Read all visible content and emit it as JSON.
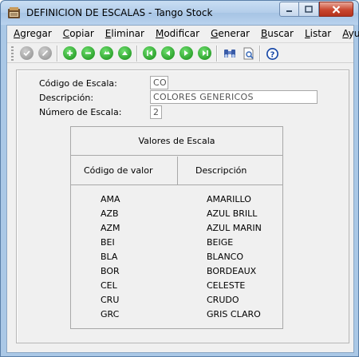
{
  "window": {
    "title": "DEFINICION DE ESCALAS - Tango Stock"
  },
  "menu": [
    {
      "label": "Agregar",
      "accel": "A",
      "rest": "gregar"
    },
    {
      "label": "Copiar",
      "accel": "C",
      "rest": "opiar"
    },
    {
      "label": "Eliminar",
      "accel": "E",
      "rest": "liminar"
    },
    {
      "label": "Modificar",
      "accel": "M",
      "rest": "odificar"
    },
    {
      "label": "Generar",
      "accel": "G",
      "rest": "enerar"
    },
    {
      "label": "Buscar",
      "accel": "B",
      "rest": "uscar"
    },
    {
      "label": "Listar",
      "accel": "L",
      "rest": "istar"
    },
    {
      "label": "Ayuda",
      "accel": "A",
      "rest": "yuda"
    }
  ],
  "toolbar": {
    "buttons": [
      "accept-icon",
      "cancel-icon",
      "add-icon",
      "remove-icon",
      "move-up-icon",
      "move-top-icon",
      "first-record-icon",
      "previous-record-icon",
      "next-record-icon",
      "last-record-icon",
      "binoculars-icon",
      "print-preview-icon",
      "help-icon"
    ]
  },
  "form": {
    "codigo_label": "Código de Escala:",
    "codigo_value": "CO",
    "descripcion_label": "Descripción:",
    "descripcion_value": "COLORES GENERICOS",
    "numero_label": "Número de Escala:",
    "numero_value": "2"
  },
  "table": {
    "title": "Valores de Escala",
    "col_code": "Código de valor",
    "col_desc": "Descripción",
    "rows": [
      {
        "code": "AMA",
        "desc": "AMARILLO"
      },
      {
        "code": "AZB",
        "desc": "AZUL BRILL"
      },
      {
        "code": "AZM",
        "desc": "AZUL MARIN"
      },
      {
        "code": "BEI",
        "desc": "BEIGE"
      },
      {
        "code": "BLA",
        "desc": "BLANCO"
      },
      {
        "code": "BOR",
        "desc": "BORDEAUX"
      },
      {
        "code": "CEL",
        "desc": "CELESTE"
      },
      {
        "code": "CRU",
        "desc": "CRUDO"
      },
      {
        "code": "GRC",
        "desc": "GRIS CLARO"
      }
    ]
  },
  "colors": {
    "titlebar": "#b3cdea",
    "client_bg": "#f0f0f0",
    "toolbar_green": "#138a13",
    "close_button": "#c9472f"
  }
}
